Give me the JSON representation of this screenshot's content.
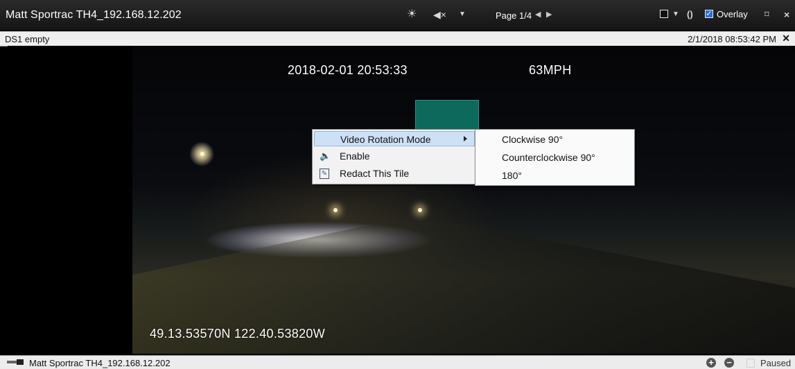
{
  "window": {
    "title": "Matt Sportrac TH4_192.168.12.202",
    "page_label": "Page 1/4",
    "overlay_label": "Overlay",
    "overlay_checked": true
  },
  "infobar": {
    "source": "DS1  empty",
    "timestamp": "2/1/2018 08:53:42 PM"
  },
  "video": {
    "datetime": "2018-02-01 20:53:33",
    "speed": "63MPH",
    "coordinates": "49.13.53570N 122.40.53820W"
  },
  "context_menu": {
    "items": [
      {
        "label": "Video Rotation Mode",
        "icon": "",
        "has_submenu": true,
        "highlighted": true
      },
      {
        "label": "Enable",
        "icon": "speaker-icon",
        "has_submenu": false,
        "highlighted": false
      },
      {
        "label": "Redact This Tile",
        "icon": "redact-pen-icon",
        "has_submenu": false,
        "highlighted": false
      }
    ],
    "submenu": [
      "Clockwise 90°",
      "Counterclockwise 90°",
      "180°"
    ]
  },
  "bottombar": {
    "camera_name": "Matt Sportrac TH4_192.168.12.202",
    "status": "Paused"
  },
  "colors": {
    "titlebar": "#1e1e1e",
    "menu_highlight": "#cde0f5",
    "checkbox_blue": "#2a6fd6"
  }
}
